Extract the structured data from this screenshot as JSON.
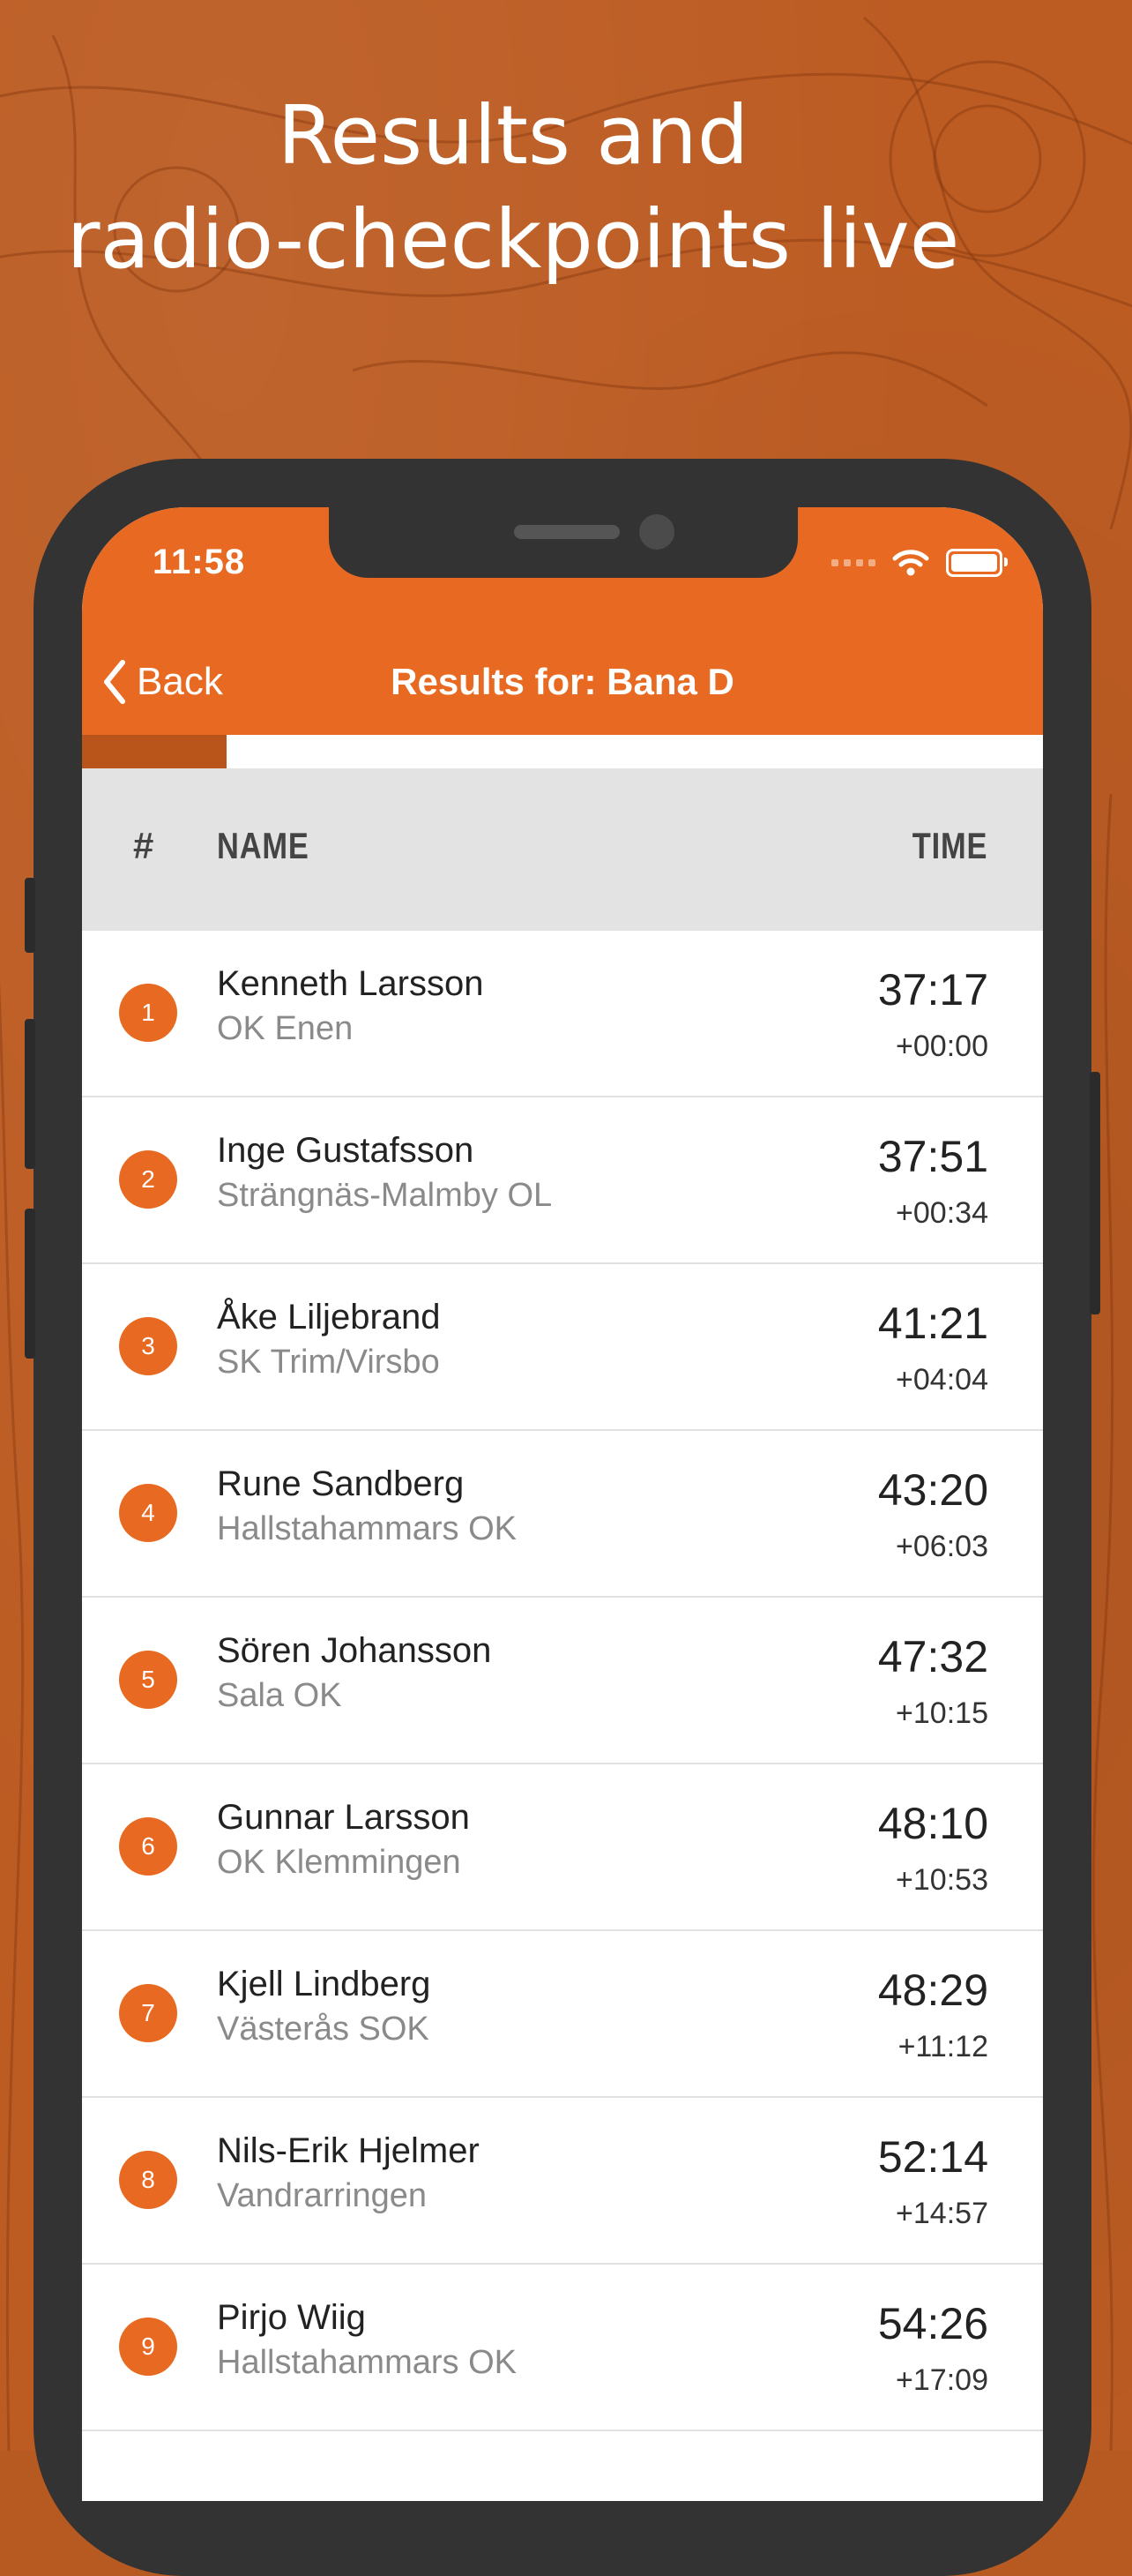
{
  "headline": {
    "line1": "Results and",
    "line2": "radio-checkpoints live"
  },
  "status_bar": {
    "time": "11:58",
    "icons": [
      "signal-icon",
      "wifi-icon",
      "battery-icon"
    ]
  },
  "nav": {
    "back_label": "Back",
    "title": "Results for: Bana D"
  },
  "progress": {
    "value_fraction": 0.15
  },
  "table": {
    "headers": {
      "rank": "#",
      "name": "NAME",
      "time": "TIME"
    },
    "rows": [
      {
        "rank": "1",
        "name": "Kenneth Larsson",
        "club": "OK Enen",
        "time": "37:17",
        "diff": "+00:00"
      },
      {
        "rank": "2",
        "name": "Inge Gustafsson",
        "club": "Strängnäs-Malmby OL",
        "time": "37:51",
        "diff": "+00:34"
      },
      {
        "rank": "3",
        "name": "Åke Liljebrand",
        "club": "SK Trim/Virsbo",
        "time": "41:21",
        "diff": "+04:04"
      },
      {
        "rank": "4",
        "name": "Rune Sandberg",
        "club": "Hallstahammars OK",
        "time": "43:20",
        "diff": "+06:03"
      },
      {
        "rank": "5",
        "name": "Sören Johansson",
        "club": "Sala OK",
        "time": "47:32",
        "diff": "+10:15"
      },
      {
        "rank": "6",
        "name": "Gunnar Larsson",
        "club": "OK Klemmingen",
        "time": "48:10",
        "diff": "+10:53"
      },
      {
        "rank": "7",
        "name": "Kjell Lindberg",
        "club": "Västerås SOK",
        "time": "48:29",
        "diff": "+11:12"
      },
      {
        "rank": "8",
        "name": "Nils-Erik Hjelmer",
        "club": "Vandrarringen",
        "time": "52:14",
        "diff": "+14:57"
      },
      {
        "rank": "9",
        "name": "Pirjo Wiig",
        "club": "Hallstahammars OK",
        "time": "54:26",
        "diff": "+17:09"
      }
    ]
  },
  "colors": {
    "accent": "#e86a22",
    "background": "#bc5c23",
    "progress_fill": "#b9541b",
    "phone_frame": "#333333"
  }
}
